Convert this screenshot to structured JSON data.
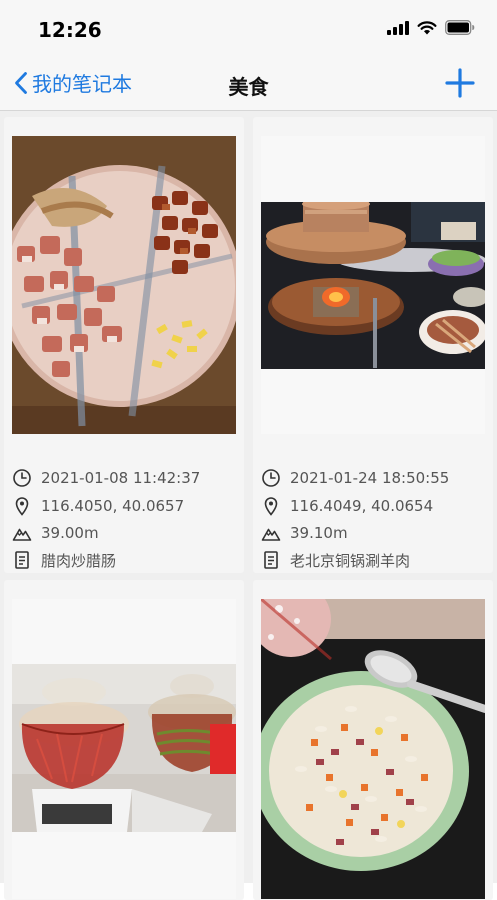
{
  "status": {
    "time": "12:26"
  },
  "nav": {
    "back_label": "我的笔记本",
    "title": "美食"
  },
  "colors": {
    "accent": "#1f7ae0"
  },
  "icons": [
    "clock-icon",
    "location-pin-icon",
    "mountain-icon",
    "document-icon",
    "chevron-left-icon",
    "plus-icon"
  ],
  "notes": [
    {
      "datetime": "2021-01-08 11:42:37",
      "coords": "116.4050, 40.0657",
      "altitude": "39.00m",
      "title": "腊肉炒腊肠"
    },
    {
      "datetime": "2021-01-24 18:50:55",
      "coords": "116.4049, 40.0654",
      "altitude": "39.10m",
      "title": "老北京铜锅涮羊肉"
    },
    {
      "datetime": "",
      "coords": "",
      "altitude": "",
      "title": ""
    },
    {
      "datetime": "",
      "coords": "",
      "altitude": "",
      "title": ""
    }
  ]
}
